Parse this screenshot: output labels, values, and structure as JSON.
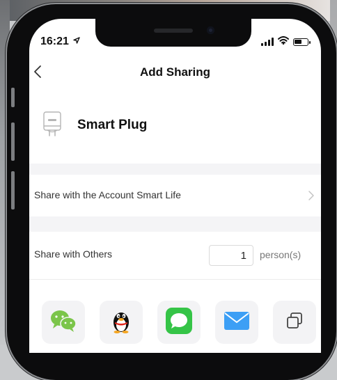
{
  "status_bar": {
    "time": "16:21",
    "location_icon": "location-arrow-icon",
    "signal_icon": "cellular-signal-icon",
    "wifi_icon": "wifi-icon",
    "battery_icon": "battery-icon",
    "battery_level": 0.6
  },
  "nav": {
    "back_icon": "chevron-left-icon",
    "title": "Add Sharing"
  },
  "device": {
    "icon": "smart-plug-icon",
    "name": "Smart Plug"
  },
  "share_account": {
    "label": "Share with the Account Smart Life",
    "chevron_icon": "chevron-right-icon"
  },
  "share_others": {
    "label": "Share with Others",
    "count": "1",
    "unit": "person(s)"
  },
  "share_apps": [
    {
      "name": "wechat",
      "icon": "wechat-icon",
      "color": "#7bc54a"
    },
    {
      "name": "qq",
      "icon": "qq-penguin-icon",
      "color": "#111111"
    },
    {
      "name": "messages",
      "icon": "message-bubble-icon",
      "color": "#35c447"
    },
    {
      "name": "mail",
      "icon": "mail-envelope-icon",
      "color": "#3d9ff5"
    },
    {
      "name": "copy",
      "icon": "copy-icon",
      "color": "#444444"
    }
  ],
  "colors": {
    "background": "#ffffff",
    "section_gap": "#f4f4f6",
    "title_text": "#111111",
    "secondary_text": "#777777"
  }
}
